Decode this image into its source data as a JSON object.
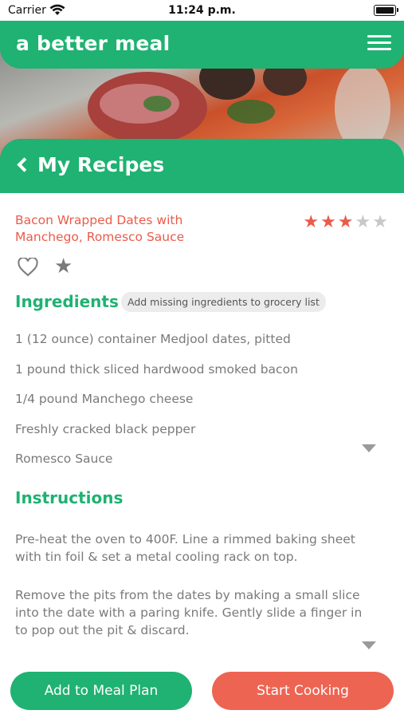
{
  "status_bar": {
    "carrier": "Carrier",
    "time": "11:24 p.m."
  },
  "app_bar": {
    "brand": "a better meal",
    "menu_icon": "hamburger-menu-icon"
  },
  "section": {
    "title": "My Recipes",
    "back_icon": "chevron-left-icon"
  },
  "recipe": {
    "title": "Bacon Wrapped Dates with Manchego, Romesco Sauce",
    "rating": {
      "value": 3,
      "max": 5
    },
    "favorite_icon": "heart-outline-icon",
    "star_icon": "star-icon"
  },
  "ingredients": {
    "heading": "Ingredients",
    "add_to_grocery_label": "Add missing ingredients to grocery list",
    "items": [
      "1 (12 ounce) container Medjool dates, pitted",
      "1 pound thick sliced hardwood smoked bacon",
      "1/4 pound Manchego cheese",
      "Freshly cracked black pepper",
      "Romesco Sauce"
    ]
  },
  "instructions": {
    "heading": "Instructions",
    "steps": [
      "Pre-heat the oven to 400F.  Line a rimmed baking sheet with tin foil & set a metal cooling rack on top.",
      "Remove the pits from the dates by making a small slice into the date with a paring knife.  Gently slide a finger in to pop out the pit & discard."
    ]
  },
  "actions": {
    "add_to_meal_plan": "Add to Meal Plan",
    "start_cooking": "Start Cooking"
  },
  "colors": {
    "brand_green": "#1fb272",
    "accent_red": "#ea5b4a",
    "cook_button": "#ee6452"
  }
}
